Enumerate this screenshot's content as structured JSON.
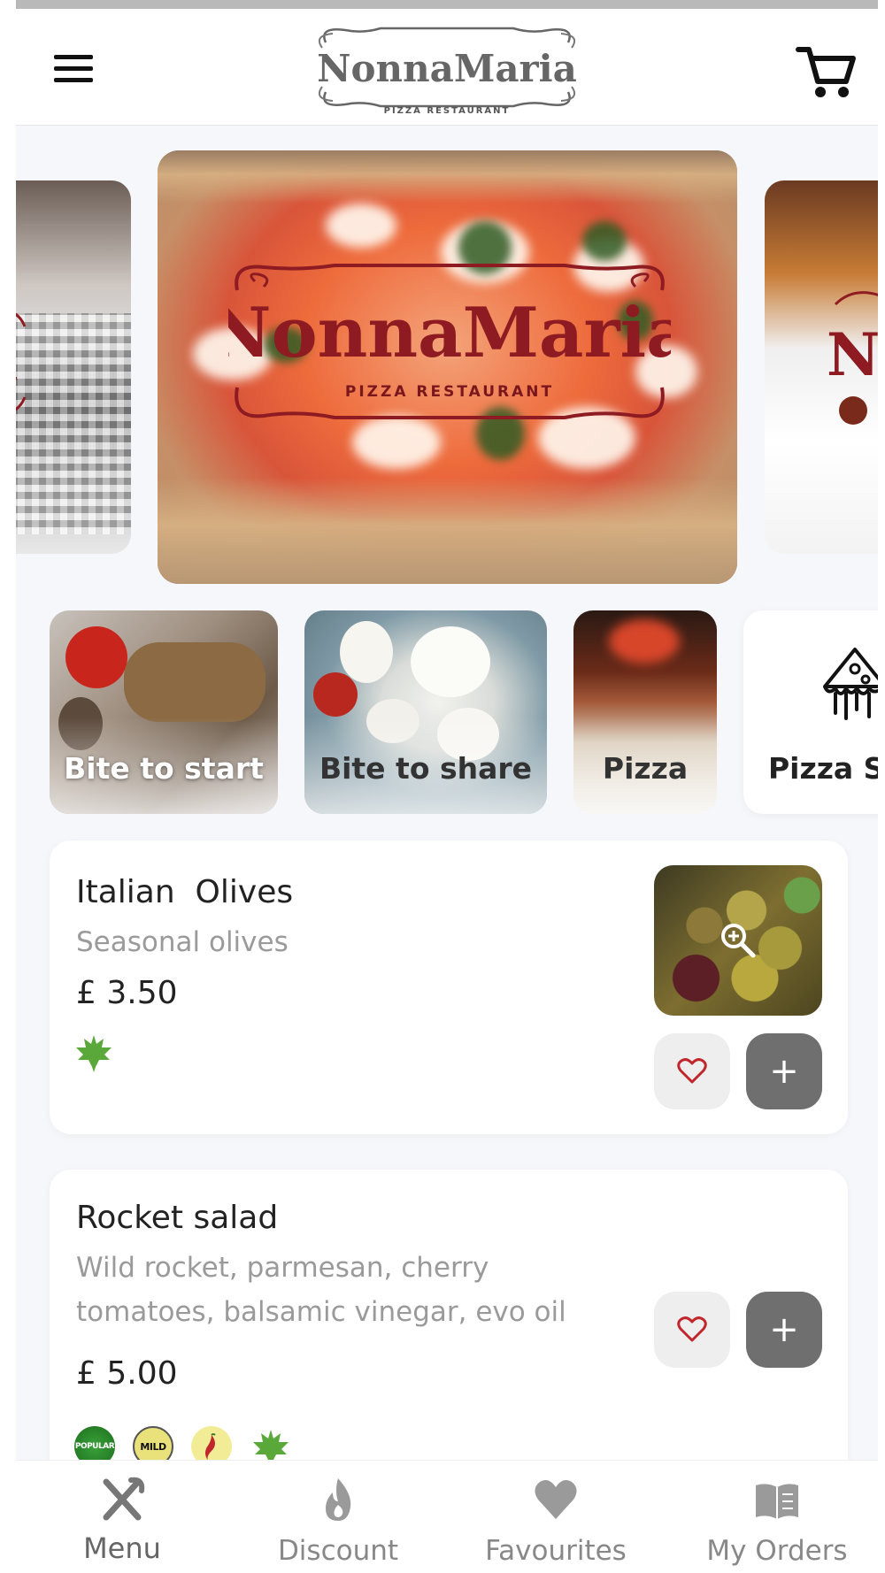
{
  "header": {
    "brand_name": "NonnaMaria",
    "brand_tagline": "PIZZA RESTAURANT"
  },
  "carousel": {
    "slides": [
      {
        "brand": "NonnaMaria",
        "tagline": "PIZZA RESTAURANT"
      }
    ]
  },
  "categories": [
    {
      "label": "Bite to start"
    },
    {
      "label": "Bite to share"
    },
    {
      "label": "Pizza"
    },
    {
      "label": "Pizza Sp",
      "icon": "pizza-special-icon"
    }
  ],
  "products": [
    {
      "name": "Italian  Olives",
      "description": "Seasonal olives",
      "price": "£ 3.50",
      "has_image": true,
      "badges": [
        "vegetarian-leaf"
      ]
    },
    {
      "name": "Rocket salad",
      "description_lines": [
        "Wild rocket, parmesan, cherry",
        "tomatoes, balsamic vinegar, evo oil"
      ],
      "price": "£ 5.00",
      "has_image": false,
      "badges": [
        {
          "type": "popular",
          "text": "POPULAR"
        },
        {
          "type": "mild",
          "text": "MILD"
        },
        {
          "type": "chilli",
          "icon": "chilli-icon"
        },
        {
          "type": "vegetarian-leaf",
          "icon": "leaf-icon"
        }
      ]
    }
  ],
  "bottom_nav": [
    {
      "label": "Menu",
      "icon": "cutlery-icon",
      "active": true
    },
    {
      "label": "Discount",
      "icon": "flame-icon",
      "active": false
    },
    {
      "label": "Favourites",
      "icon": "heart-icon",
      "active": false
    },
    {
      "label": "My Orders",
      "icon": "book-icon",
      "active": false
    }
  ],
  "colors": {
    "brand_red": "#8e1b22",
    "add_button": "#6f6f6f",
    "heart_red": "#c0262c",
    "leaf_green": "#5aa83a"
  },
  "add_label": "+"
}
